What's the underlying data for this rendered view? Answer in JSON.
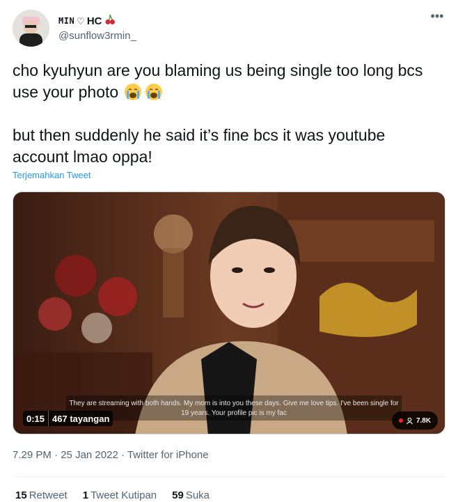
{
  "user": {
    "display_name_prefix": "MIN",
    "display_name_heart": "♡",
    "display_name_suffix": "HC",
    "emoji_icon": "cherry-icon",
    "handle": "@sunflow3rmin_"
  },
  "tweet": {
    "line1": "cho kyuhyun are you blaming us being single too long bcs use your photo",
    "line2": "but then suddenly he said it’s fine bcs it was youtube account lmao oppa!",
    "translate_label": "Terjemahkan Tweet"
  },
  "video": {
    "caption": "They are streaming with both hands. My mom is into you these days. Give me love tips. I've been single for 19 years. Your profile pic is my fac",
    "time": "0:15",
    "views": "467 tayangan",
    "viewers": "7.8K"
  },
  "meta": {
    "time": "7.29 PM",
    "date": "25 Jan 2022",
    "source": "Twitter for iPhone"
  },
  "stats": {
    "retweets_count": "15",
    "retweets_label": "Retweet",
    "quotes_count": "1",
    "quotes_label": "Tweet Kutipan",
    "likes_count": "59",
    "likes_label": "Suka"
  },
  "colors": {
    "accent": "#1d9bf0",
    "text": "#0f1419",
    "muted": "#536471"
  }
}
